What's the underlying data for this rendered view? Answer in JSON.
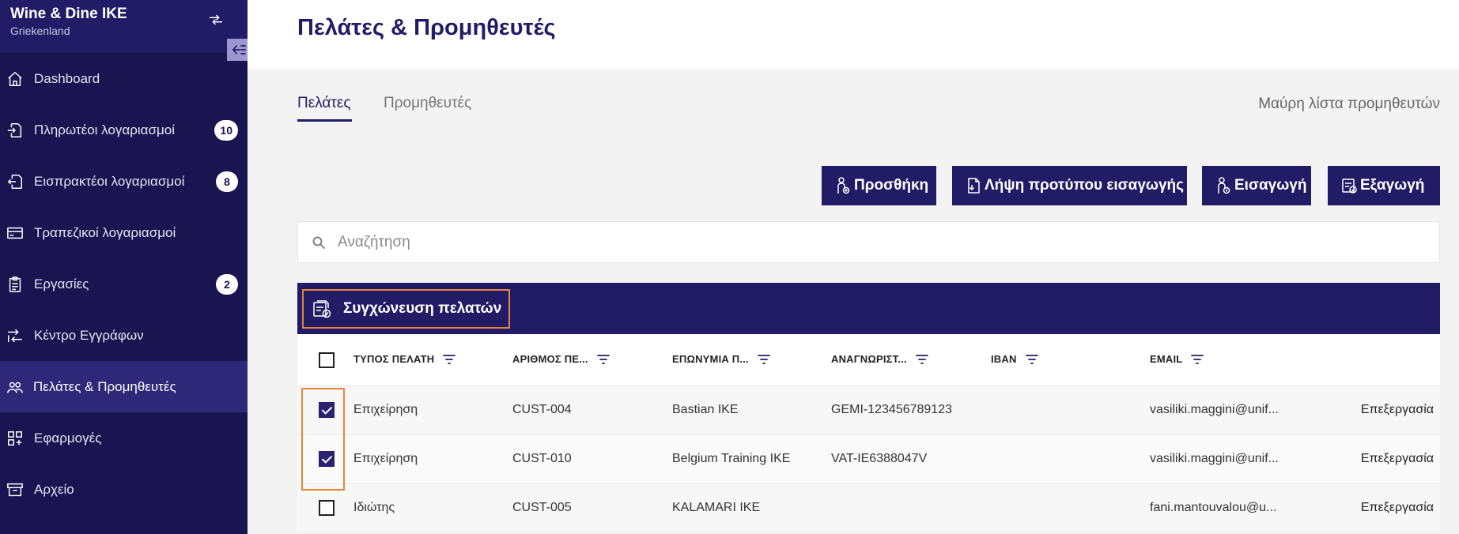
{
  "brand": {
    "name": "Wine & Dine IKE",
    "subtitle": "Griekenland"
  },
  "sidebar": {
    "items": [
      {
        "label": "Dashboard",
        "icon": "home-icon"
      },
      {
        "label": "Πληρωτέοι λογαριασμοί",
        "icon": "payables-icon",
        "badge": "10"
      },
      {
        "label": "Εισπρακτέοι λογαριασμοί",
        "icon": "receivables-icon",
        "badge": "8"
      },
      {
        "label": "Τραπεζικοί λογαριασμοί",
        "icon": "bank-card-icon"
      },
      {
        "label": "Εργασίες",
        "icon": "clipboard-icon",
        "badge": "2"
      },
      {
        "label": "Κέντρο Εγγράφων",
        "icon": "document-center-icon"
      },
      {
        "label": "Πελάτες & Προμηθευτές",
        "icon": "contacts-icon",
        "active": true
      },
      {
        "label": "Εφαρμογές",
        "icon": "apps-icon"
      },
      {
        "label": "Αρχείο",
        "icon": "archive-icon"
      }
    ]
  },
  "header": {
    "title": "Πελάτες & Προμηθευτές"
  },
  "tabs": [
    {
      "label": "Πελάτες",
      "active": true
    },
    {
      "label": "Προμηθευτές",
      "active": false
    }
  ],
  "blacklist_link": "Μαύρη λίστα προμηθευτών",
  "actions": {
    "add": "Προσθήκη",
    "template": "Λήψη προτύπου εισαγωγής",
    "import": "Εισαγωγή",
    "export": "Εξαγωγή"
  },
  "search": {
    "placeholder": "Αναζήτηση",
    "value": ""
  },
  "merge": {
    "label": "Συγχώνευση πελατών"
  },
  "table": {
    "columns": [
      "ΤΥΠΟΣ ΠΕΛΑΤΗ",
      "ΑΡΙΘΜΟΣ ΠΕ...",
      "ΕΠΩΝΥΜΙΑ Π...",
      "ΑΝΑΓΝΩΡΙΣΤ...",
      "IBAN",
      "EMAIL"
    ],
    "edit_label": "Επεξεργασία",
    "rows": [
      {
        "checked": true,
        "type": "Επιχείρηση",
        "number": "CUST-004",
        "name": "Bastian IKE",
        "identifier": "GEMI-123456789123",
        "iban": "",
        "email": "vasiliki.maggini@unif..."
      },
      {
        "checked": true,
        "type": "Επιχείρηση",
        "number": "CUST-010",
        "name": "Belgium Training IKE",
        "identifier": "VAT-IE6388047V",
        "iban": "",
        "email": "vasiliki.maggini@unif..."
      },
      {
        "checked": false,
        "type": "Ιδιώτης",
        "number": "CUST-005",
        "name": "KALAMARI IKE",
        "identifier": "",
        "iban": "",
        "email": "fani.mantouvalou@u..."
      }
    ]
  },
  "colors": {
    "primary": "#221c66",
    "sidebar": "#1a1550",
    "highlight": "#e8833a"
  }
}
